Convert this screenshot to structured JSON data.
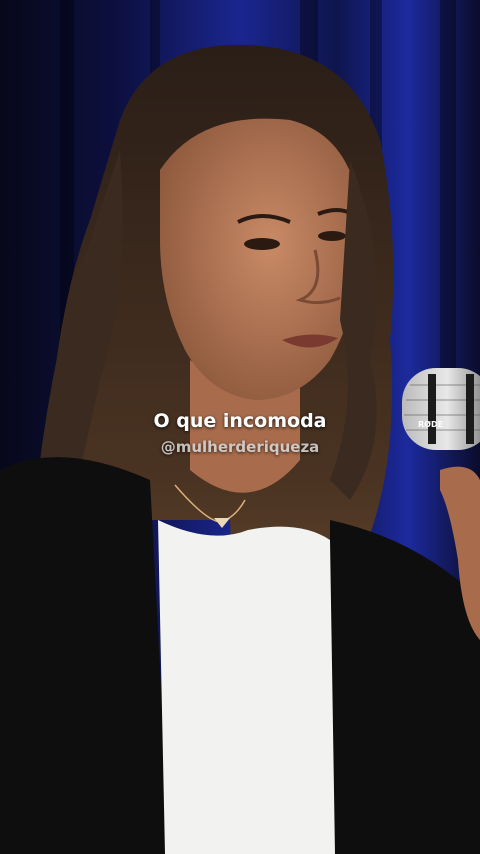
{
  "caption": {
    "main": "O que incomoda",
    "handle": "@mulherderiqueza"
  },
  "mic_brand": "RØDE",
  "colors": {
    "curtain_dark": "#0b0c2a",
    "curtain_blue": "#1c2a9e",
    "hair": "#3a2a20",
    "skin": "#b77a58",
    "jacket": "#0e0e0e",
    "shirt": "#f2f2f0"
  }
}
